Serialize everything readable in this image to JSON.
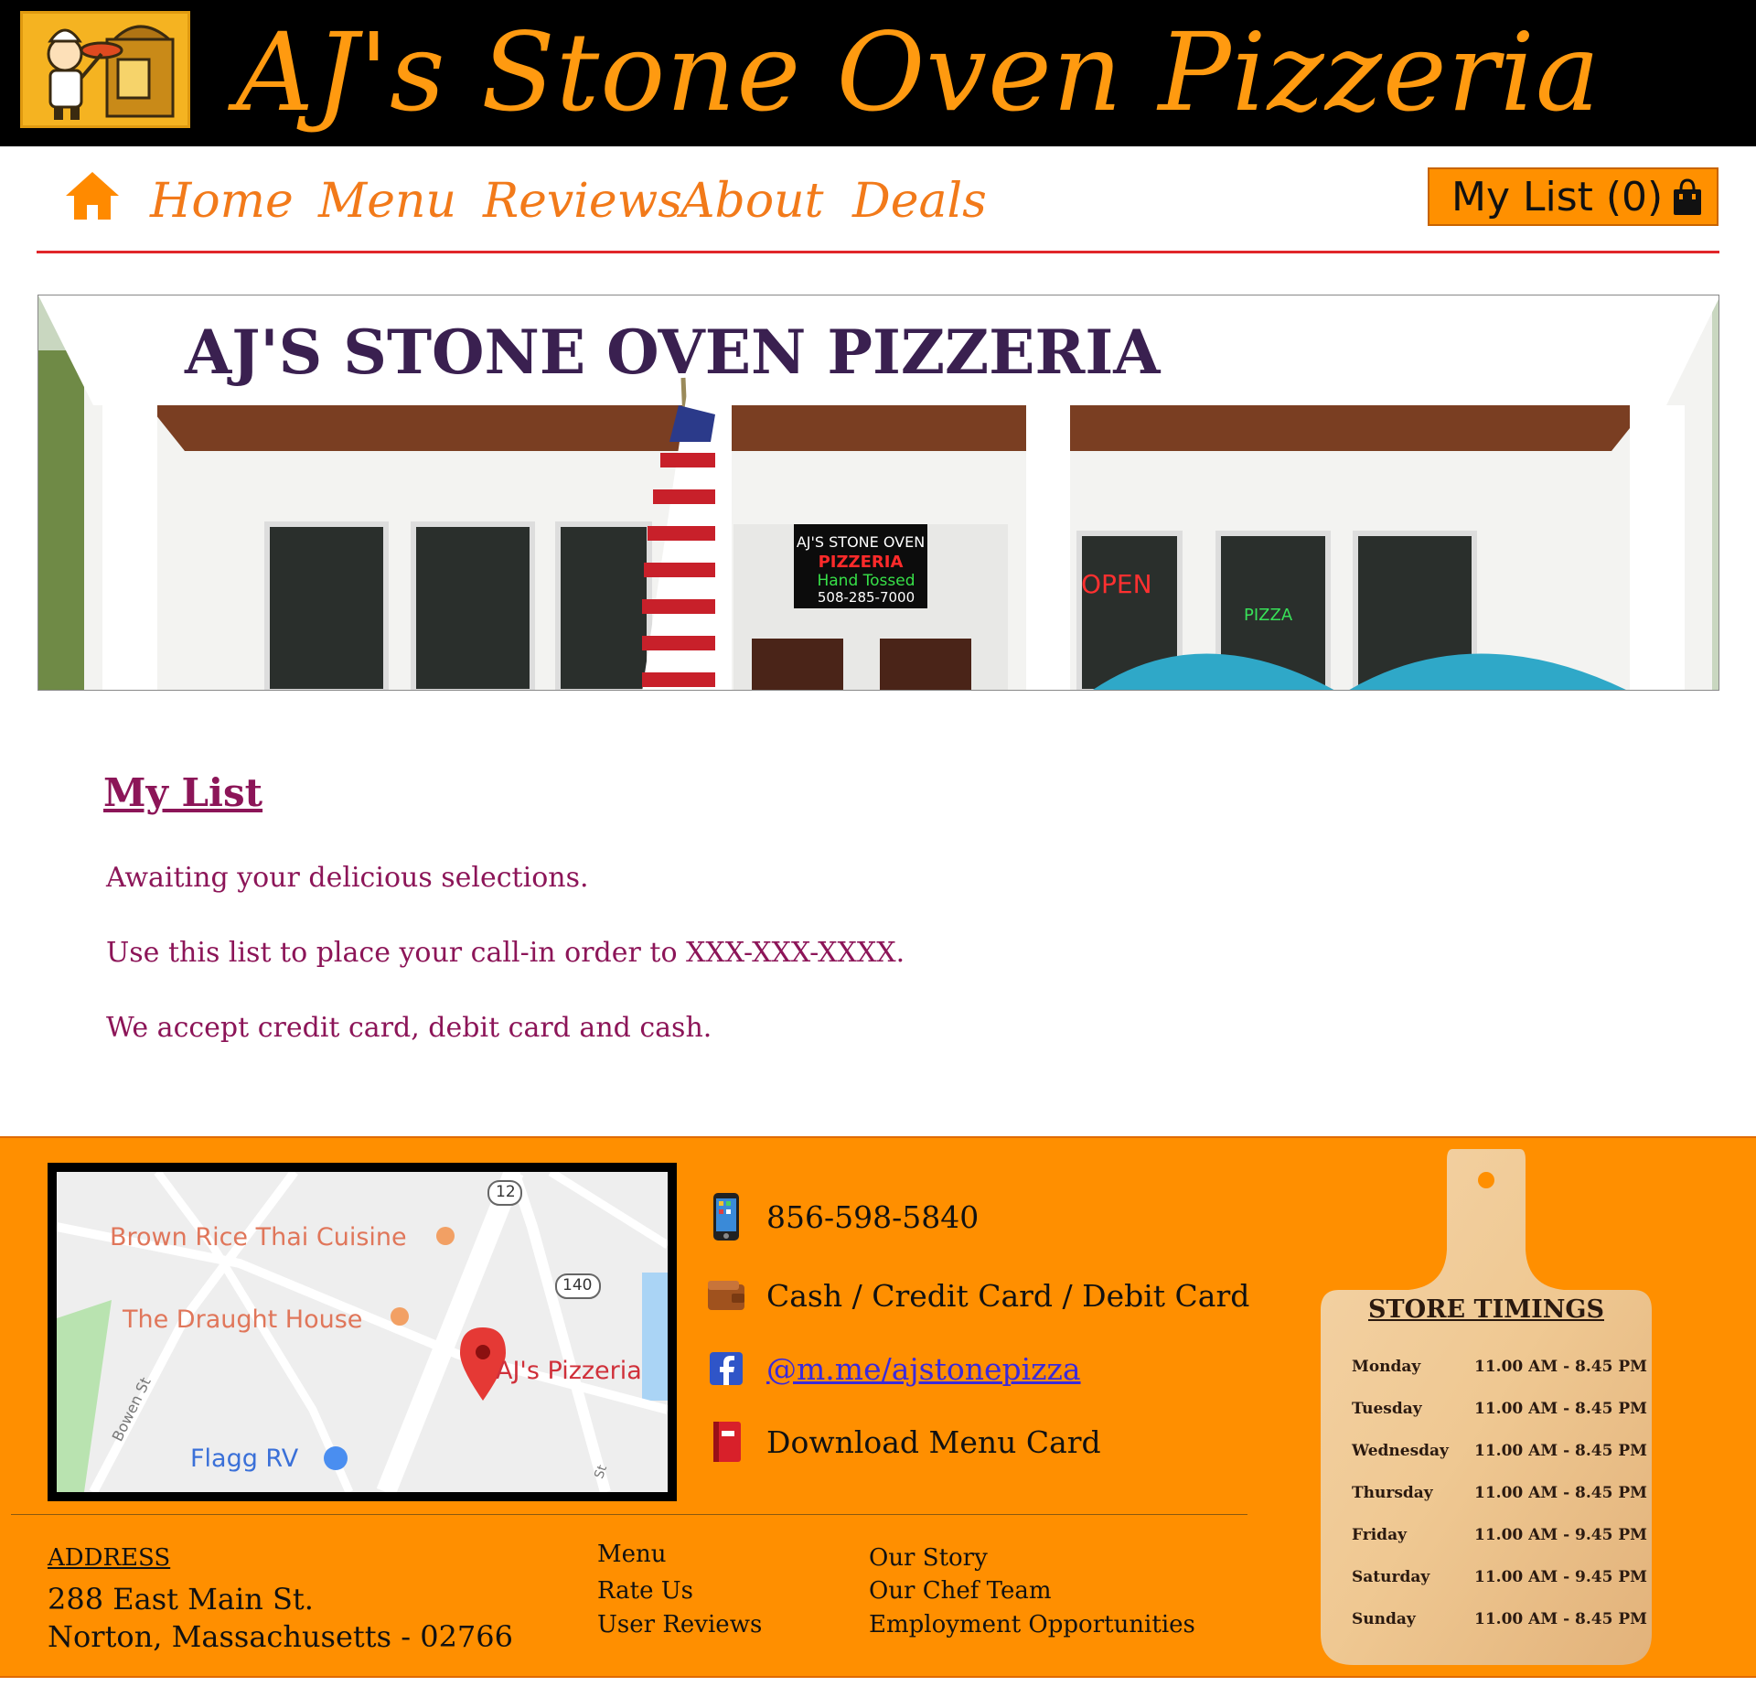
{
  "header": {
    "title": "AJ's Stone Oven Pizzeria"
  },
  "nav": {
    "items": [
      "Home",
      "Menu",
      "Reviews",
      "About",
      "Deals"
    ],
    "my_list_label": "My List (0)"
  },
  "banner": {
    "sign_text": "AJ'S STONE OVEN PIZZERIA",
    "window_sign_1": "AJ'S STONE OVEN",
    "window_sign_2": "PIZZERIA",
    "window_sign_3": "Hand Tossed",
    "window_sign_4": "508-285-7000",
    "open_sign": "OPEN",
    "pizza_sign": "PIZZA"
  },
  "content": {
    "heading": "My List",
    "paragraphs": [
      "Awaiting your delicious selections.",
      "Use this list to place your call-in order to XXX-XXX-XXXX.",
      "We accept credit card, debit card and cash."
    ]
  },
  "map": {
    "labels": {
      "place_1": "Brown Rice Thai Cuisine",
      "place_2": "The Draught House",
      "place_3": "AJ's Pizzeria",
      "place_4": "Flagg RV",
      "street_1": "Bowen St",
      "street_2": "St",
      "route_1": "12",
      "route_2": "140"
    }
  },
  "contact": {
    "phone": "856-598-5840",
    "payment": "Cash / Credit Card / Debit Card",
    "facebook": "@m.me/ajstonepizza",
    "download": "Download Menu Card"
  },
  "address": {
    "title": "ADDRESS",
    "line1": "288 East Main St.",
    "line2": "Norton, Massachusetts - 02766"
  },
  "footer_links": {
    "col1": [
      "Menu",
      "Rate Us",
      "User Reviews"
    ],
    "col2": [
      "Our Story",
      "Our Chef Team",
      "Employment Opportunities"
    ]
  },
  "timings": {
    "title": "STORE TIMINGS",
    "rows": [
      {
        "day": "Monday",
        "hours": "11.00 AM - 8.45 PM"
      },
      {
        "day": "Tuesday",
        "hours": "11.00 AM - 8.45 PM"
      },
      {
        "day": "Wednesday",
        "hours": "11.00 AM - 8.45 PM"
      },
      {
        "day": "Thursday",
        "hours": "11.00 AM - 8.45 PM"
      },
      {
        "day": "Friday",
        "hours": "11.00 AM - 9.45 PM"
      },
      {
        "day": "Saturday",
        "hours": "11.00 AM - 9.45 PM"
      },
      {
        "day": "Sunday",
        "hours": "11.00 AM - 8.45 PM"
      }
    ]
  },
  "colors": {
    "brand_orange": "#ff8f00",
    "title_orange": "#ff9a10",
    "accent_red": "#e0262a",
    "text_maroon": "#8c1558"
  },
  "icons": [
    "home-icon",
    "shopping-bag-icon",
    "phone-icon",
    "wallet-icon",
    "facebook-icon",
    "menu-card-icon",
    "map-pin-icon"
  ]
}
